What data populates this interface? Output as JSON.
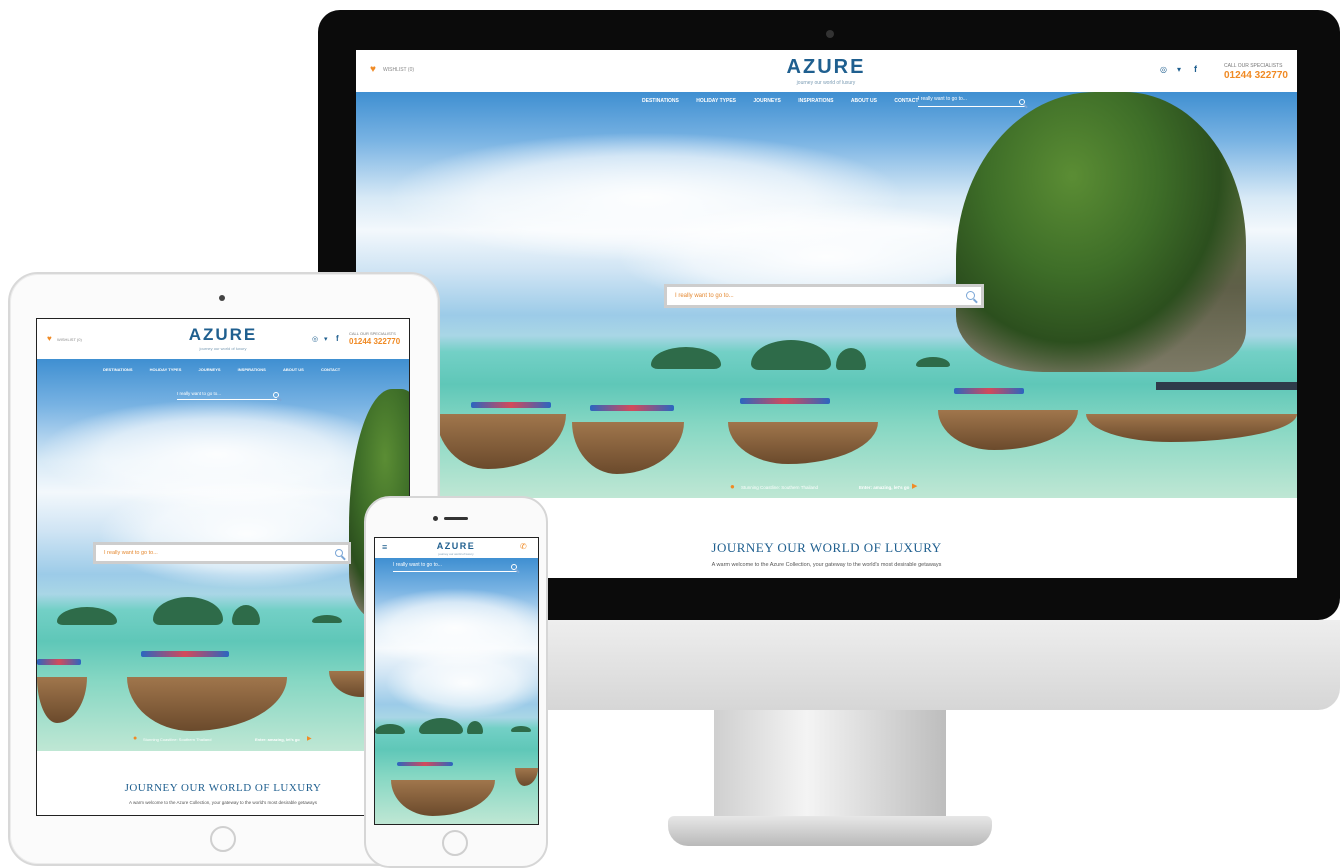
{
  "brand": {
    "logo": "AZURE",
    "tagline": "journey our world of luxury"
  },
  "header": {
    "wishlist_label": "WISHLIST (0)",
    "call_label": "CALL OUR SPECIALISTS",
    "phone": "01244 322770"
  },
  "nav": {
    "items": [
      "DESTINATIONS",
      "HOLIDAY TYPES",
      "JOURNEYS",
      "INSPIRATIONS",
      "ABOUT US",
      "CONTACT"
    ],
    "search_placeholder": "I really want to go to..."
  },
  "hero": {
    "search_placeholder": "I really want to go to...",
    "location_caption": "Stunning Coastline: Southern Thailand",
    "cta": "Enter: amazing, let's go"
  },
  "intro": {
    "heading": "JOURNEY OUR WORLD OF LUXURY",
    "text": "A warm welcome to the Azure Collection, your gateway to the world's most desirable getaways"
  },
  "icons": [
    "heart-icon",
    "instagram-icon",
    "twitter-icon",
    "facebook-icon",
    "search-icon",
    "map-pin-icon",
    "play-arrow-icon",
    "hamburger-icon",
    "phone-icon"
  ],
  "colors": {
    "accent": "#f08a24",
    "brand_blue": "#1f5f8f",
    "device_black": "#0b0b0b"
  }
}
